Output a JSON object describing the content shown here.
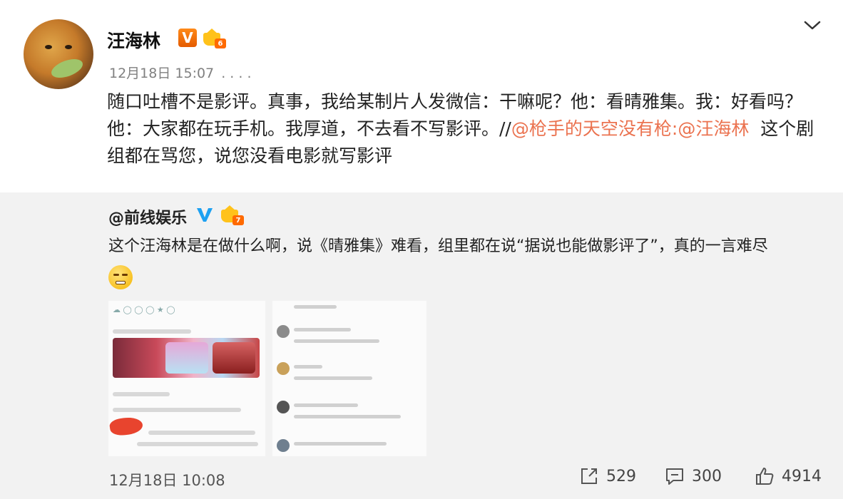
{
  "post": {
    "username": "汪海林",
    "verified_badge": "V",
    "level_badge": "6",
    "time": "12月18日 15:07",
    "more_dots": ". . . .",
    "text_part1": "随口吐槽不是影评。真事，我给某制片人发微信：干嘛呢？他：看晴雅集。我：好看吗？他：大家都在玩手机。我厚道，不去看不写影评。//",
    "mention1": "@枪手的天空没有枪",
    "colon": ":",
    "mention2": "@汪海林",
    "text_part2": "  这个剧组都在骂您，说您没看电影就写影评"
  },
  "repost": {
    "username": "@前线娱乐",
    "level_badge": "7",
    "text": "这个汪海林是在做什么啊，说《晴雅集》难看，组里都在说“据说也能做影评了”，真的一言难尽",
    "emoji": "smirk-emoji",
    "time": "12月18日 10:08",
    "repost_count": "529",
    "comment_count": "300",
    "like_count": "4914"
  },
  "colors": {
    "mention": "#eb7350",
    "repost_bg": "#f2f2f2",
    "badge_orange": "#ff8a1a",
    "badge_blue": "#1da1f2"
  }
}
